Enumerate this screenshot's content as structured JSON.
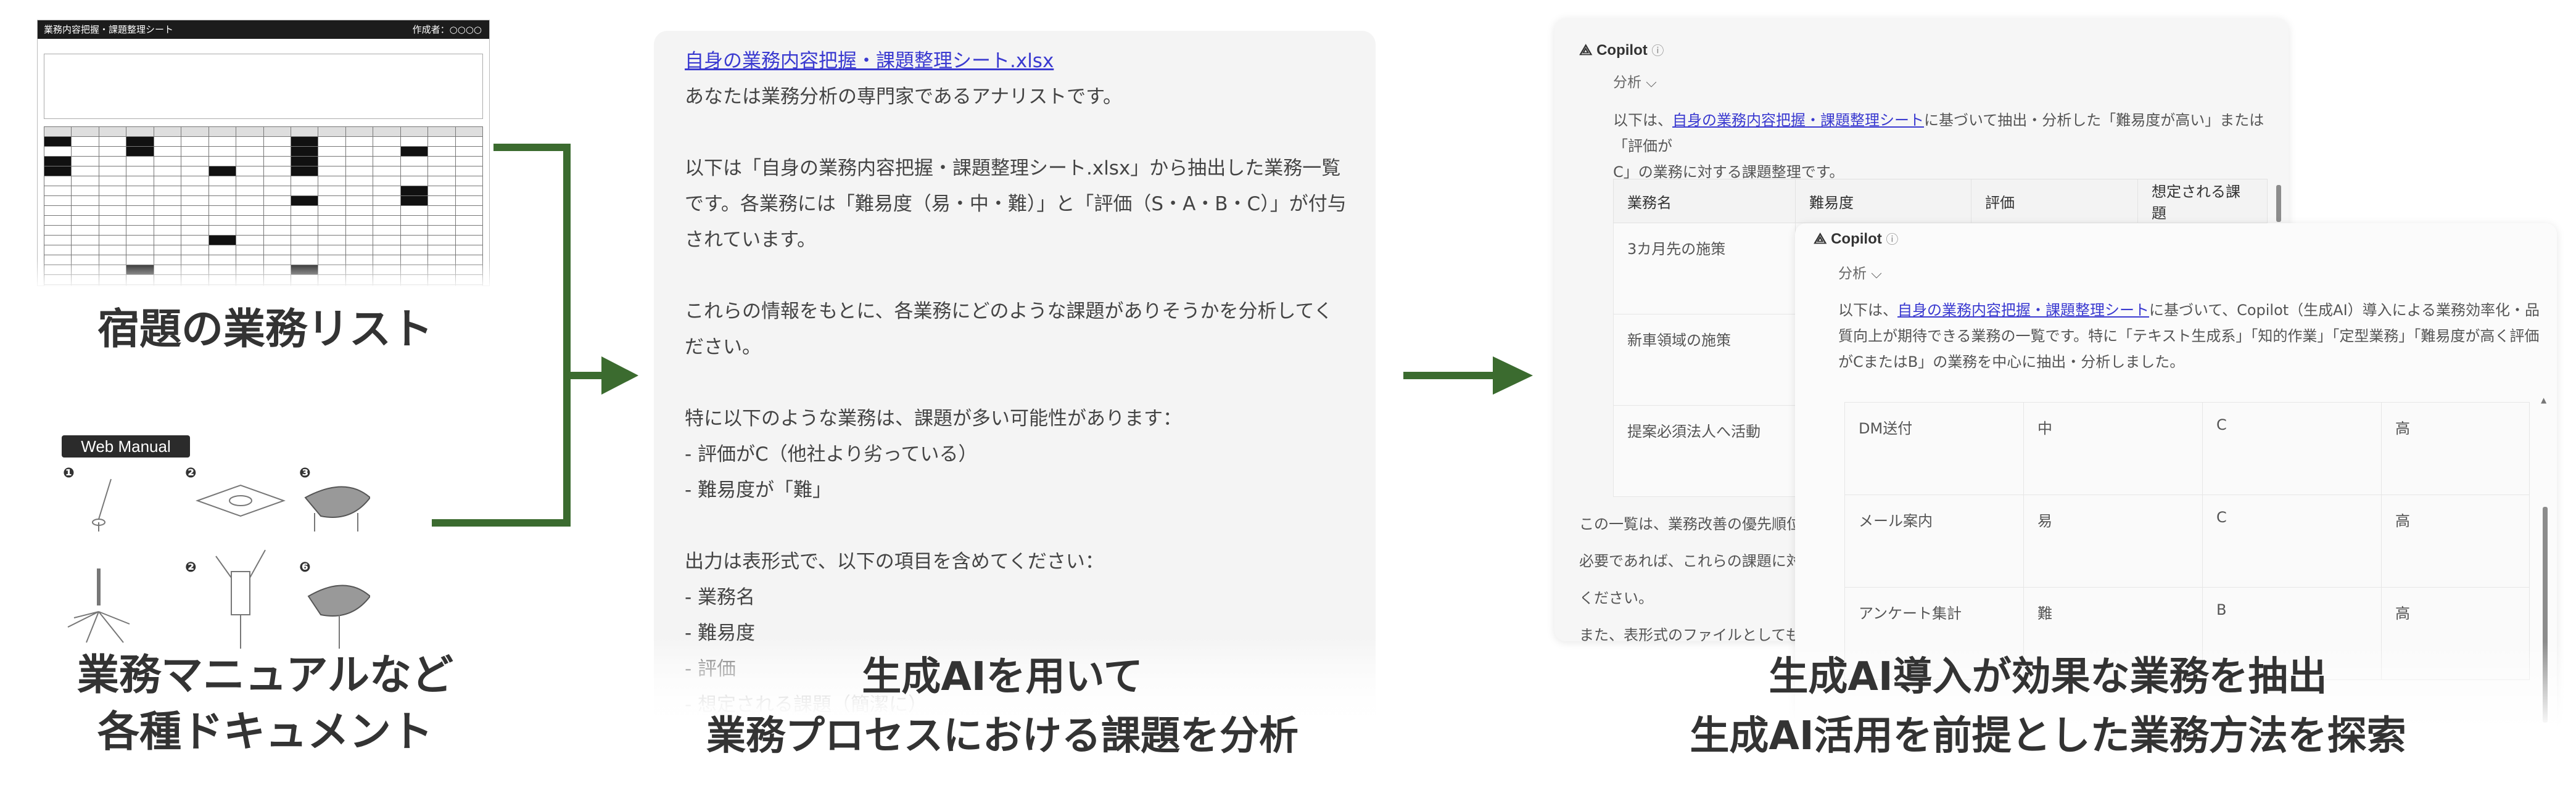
{
  "panel_1": {
    "sheet": {
      "title": "業務内容把握・課題整理シート",
      "header_right": "作成者：○○○○"
    },
    "caption_top": "宿題の業務リスト",
    "web_manual_badge": "Web Manual",
    "caption_bottom_line1": "業務マニュアルなど",
    "caption_bottom_line2": "各種ドキュメント"
  },
  "panel_2": {
    "file_link": "自身の業務内容把握・課題整理シート.xlsx",
    "lines": [
      "あなたは業務分析の専門家であるアナリストです。",
      "",
      "以下は「自身の業務内容把握・課題整理シート.xlsx」から抽出した業務一覧",
      "です。各業務には「難易度（易・中・難）」と「評価（S・A・B・C）」が付与",
      "されています。",
      "",
      "これらの情報をもとに、各業務にどのような課題がありそうかを分析してく",
      "ださい。",
      "",
      "特に以下のような業務は、課題が多い可能性があります：",
      "- 評価がC（他社より劣っている）",
      "- 難易度が「難」",
      "",
      "出力は表形式で、以下の項目を含めてください：",
      "- 業務名",
      "- 難易度",
      "- 評価",
      "- 想定される課題（簡潔に）"
    ],
    "caption_line1": "生成AIを用いて",
    "caption_line2": "業務プロセスにおける課題を分析"
  },
  "panel_3": {
    "back_card": {
      "app_name": "Copilot",
      "mode": "分析 ⌵",
      "intro_pre": "以下は、",
      "intro_link": "自身の業務内容把握・課題整理シート",
      "intro_post1": "に基づいて抽出・分析した「難易度が高い」または「評価が",
      "intro_line2": "C」の業務に対する課題整理です。",
      "columns": [
        "業務名",
        "難易度",
        "評価",
        "想定される課題"
      ],
      "rows": [
        "3カ月先の施策",
        "新車領域の施策",
        "提案必須法人へ活動"
      ],
      "footer_line1": "この一覧は、業務改善の優先順位",
      "footer_line2": "必要であれば、これらの課題に対",
      "footer_line3": "ください。",
      "footer_line4": "また、表形式のファイルとしても"
    },
    "front_card": {
      "app_name": "Copilot",
      "mode": "分析 ⌵",
      "intro_pre": "以下は、",
      "intro_link": "自身の業務内容把握・課題整理シート",
      "intro_post1": "に基づいて、Copilot（生成AI）導入による業務効率化・品",
      "intro_line2": "質向上が期待できる業務の一覧です。特に「テキスト生成系」「知的作業」「定型業務」「難易度が高く評価",
      "intro_line3": "がCまたはB」の業務を中心に抽出・分析しました。",
      "rows": [
        {
          "name": "DM送付",
          "difficulty": "中",
          "grade": "C",
          "effect": "高"
        },
        {
          "name": "メール案内",
          "difficulty": "易",
          "grade": "C",
          "effect": "高"
        },
        {
          "name": "アンケート集計",
          "difficulty": "難",
          "grade": "B",
          "effect": "高"
        }
      ]
    },
    "caption_line1": "生成AI導入が効果な業務を抽出",
    "caption_line2": "生成AI活用を前提とした業務方法を探索"
  },
  "colors": {
    "connector": "#3b6b2f",
    "link": "#3a3ad0",
    "caption": "#333333"
  }
}
